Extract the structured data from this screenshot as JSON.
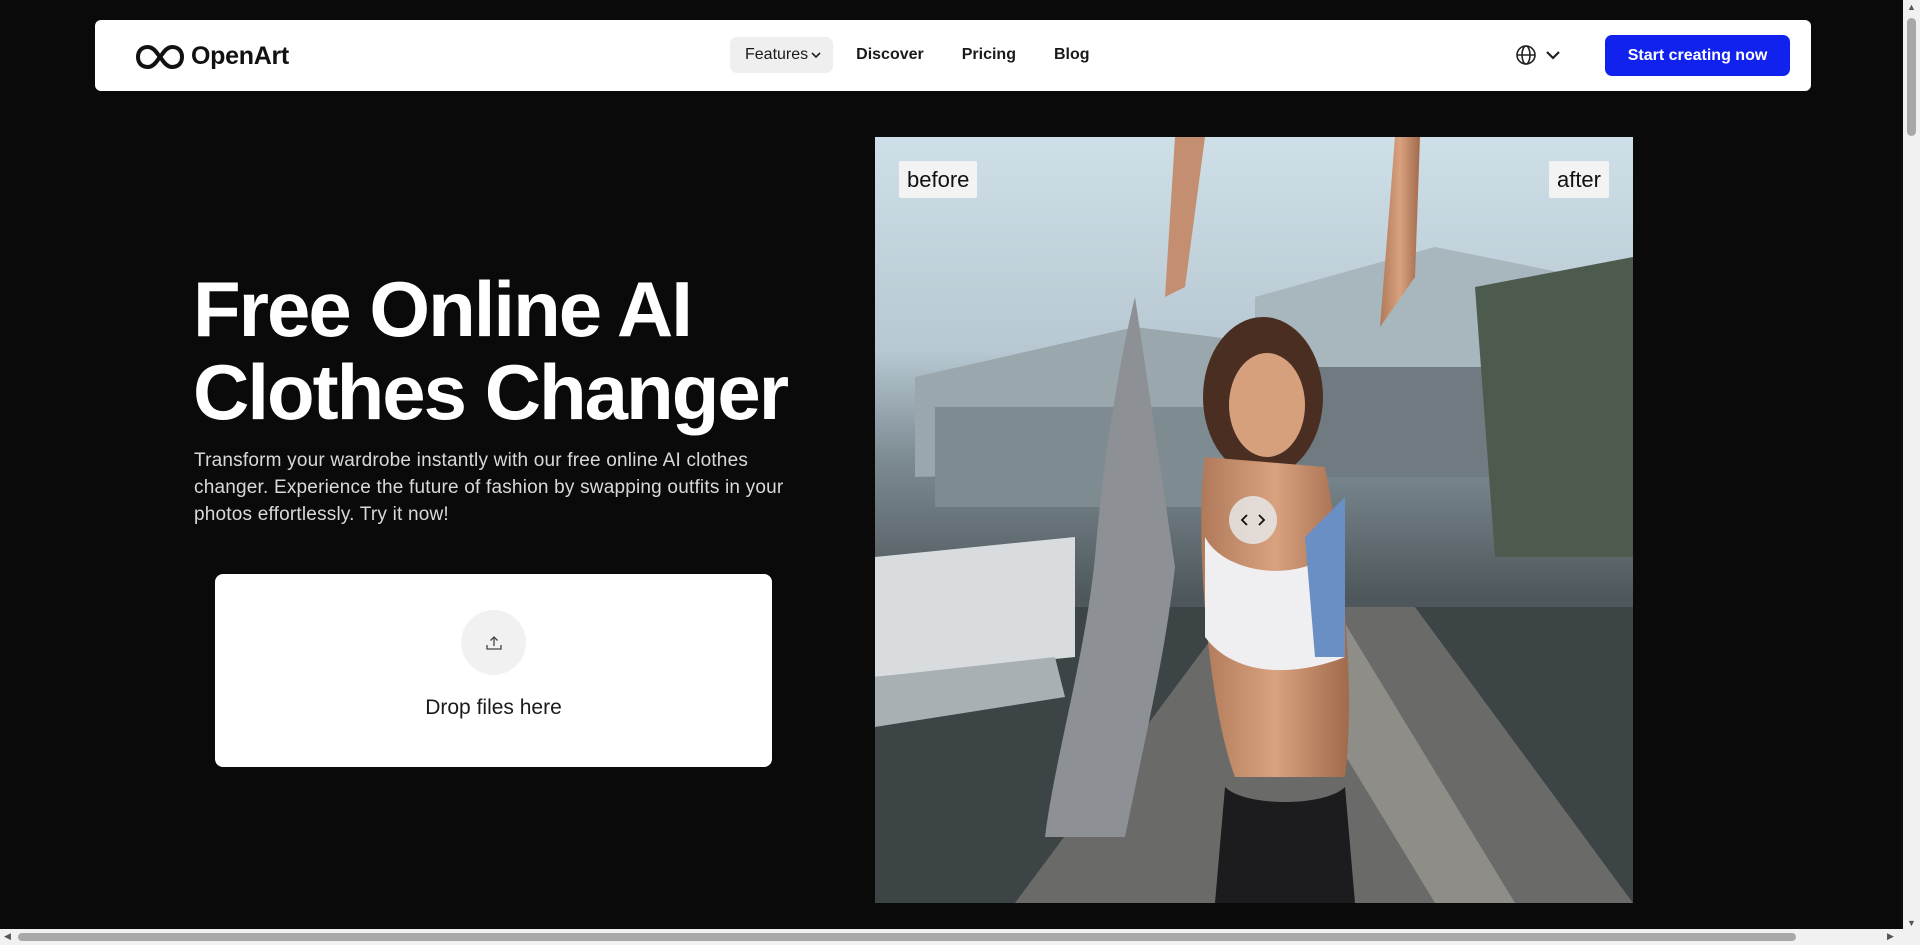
{
  "header": {
    "brand": "OpenArt",
    "nav": [
      {
        "label": "Features",
        "has_dropdown": true,
        "active": true
      },
      {
        "label": "Discover"
      },
      {
        "label": "Pricing"
      },
      {
        "label": "Blog"
      }
    ],
    "language_icon": "globe-icon",
    "cta_label": "Start creating now",
    "accent_color": "#1122ee"
  },
  "hero": {
    "title_line1": "Free Online AI",
    "title_line2": "Clothes Changer",
    "description": "Transform your wardrobe instantly with our free online AI clothes changer. Experience the future of fashion by swapping outfits in your photos effortlessly. Try it now!",
    "dropzone_label": "Drop files here",
    "upload_icon": "upload-icon"
  },
  "compare": {
    "before_label": "before",
    "after_label": "after",
    "handle_icon": "chevrons-left-right-icon"
  }
}
